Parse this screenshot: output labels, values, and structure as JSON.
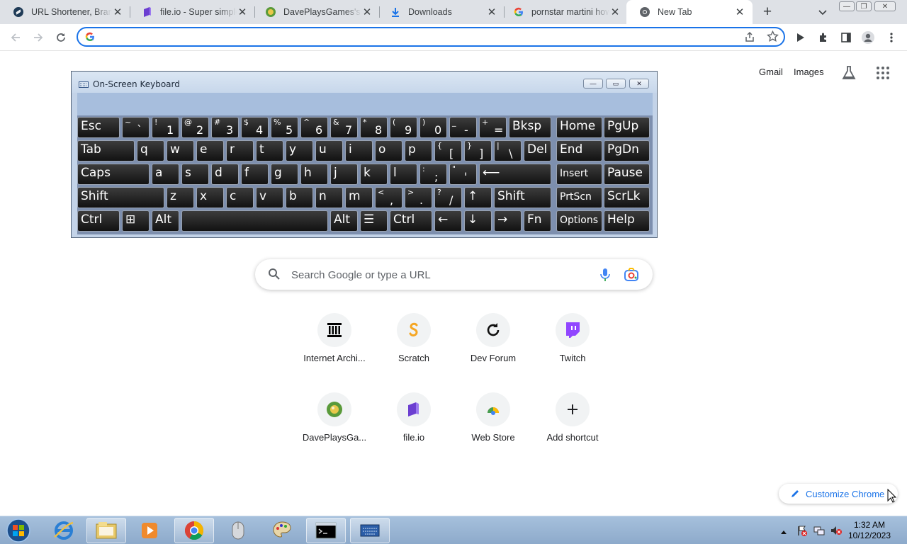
{
  "tabs": [
    {
      "title": "URL Shortener, Branded Short Links & Analytics",
      "icon": "link-icon"
    },
    {
      "title": "file.io - Super simple file sharing",
      "icon": "fileio-icon"
    },
    {
      "title": "DavePlaysGames's website",
      "icon": "globe-icon"
    },
    {
      "title": "Downloads",
      "icon": "download-icon"
    },
    {
      "title": "pornstar martini how to make",
      "icon": "google-icon"
    },
    {
      "title": "New Tab",
      "icon": "chrome-icon"
    }
  ],
  "omnibox": {
    "value": "",
    "placeholder": ""
  },
  "ntp_links": {
    "gmail": "Gmail",
    "images": "Images"
  },
  "osk": {
    "title": "On-Screen Keyboard",
    "rows": [
      [
        {
          "k": "Esc"
        },
        {
          "s": "~",
          "m": "`"
        },
        {
          "s": "!",
          "m": "1"
        },
        {
          "s": "@",
          "m": "2"
        },
        {
          "s": "#",
          "m": "3"
        },
        {
          "s": "$",
          "m": "4"
        },
        {
          "s": "%",
          "m": "5"
        },
        {
          "s": "^",
          "m": "6"
        },
        {
          "s": "&",
          "m": "7"
        },
        {
          "s": "*",
          "m": "8"
        },
        {
          "s": "(",
          "m": "9"
        },
        {
          "s": ")",
          "m": "0"
        },
        {
          "s": "_",
          "m": "-"
        },
        {
          "s": "+",
          "m": "="
        },
        {
          "k": "Bksp"
        },
        {
          "k": "Home"
        },
        {
          "k": "PgUp"
        }
      ],
      [
        {
          "k": "Tab"
        },
        {
          "k": "q"
        },
        {
          "k": "w"
        },
        {
          "k": "e"
        },
        {
          "k": "r"
        },
        {
          "k": "t"
        },
        {
          "k": "y"
        },
        {
          "k": "u"
        },
        {
          "k": "i"
        },
        {
          "k": "o"
        },
        {
          "k": "p"
        },
        {
          "s": "{",
          "m": "["
        },
        {
          "s": "}",
          "m": "]"
        },
        {
          "s": "|",
          "m": "\\"
        },
        {
          "k": "Del"
        },
        {
          "k": "End"
        },
        {
          "k": "PgDn"
        }
      ],
      [
        {
          "k": "Caps"
        },
        {
          "k": "a"
        },
        {
          "k": "s"
        },
        {
          "k": "d"
        },
        {
          "k": "f"
        },
        {
          "k": "g"
        },
        {
          "k": "h"
        },
        {
          "k": "j"
        },
        {
          "k": "k"
        },
        {
          "k": "l"
        },
        {
          "s": ":",
          "m": ";"
        },
        {
          "s": "\"",
          "m": "'"
        },
        {
          "k": "⟵"
        },
        {
          "k": "Insert"
        },
        {
          "k": "Pause"
        }
      ],
      [
        {
          "k": "Shift"
        },
        {
          "k": "z"
        },
        {
          "k": "x"
        },
        {
          "k": "c"
        },
        {
          "k": "v"
        },
        {
          "k": "b"
        },
        {
          "k": "n"
        },
        {
          "k": "m"
        },
        {
          "s": "<",
          "m": ","
        },
        {
          "s": ">",
          "m": "."
        },
        {
          "s": "?",
          "m": "/"
        },
        {
          "k": "↑"
        },
        {
          "k": "Shift"
        },
        {
          "k": "PrtScn"
        },
        {
          "k": "ScrLk"
        }
      ],
      [
        {
          "k": "Ctrl"
        },
        {
          "k": "⊞"
        },
        {
          "k": "Alt"
        },
        {
          "k": ""
        },
        {
          "k": "Alt"
        },
        {
          "k": "☰"
        },
        {
          "k": "Ctrl"
        },
        {
          "k": "←"
        },
        {
          "k": "↓"
        },
        {
          "k": "→"
        },
        {
          "k": "Fn"
        },
        {
          "k": "Options"
        },
        {
          "k": "Help"
        }
      ]
    ]
  },
  "search": {
    "placeholder": "Search Google or type a URL"
  },
  "shortcuts": [
    {
      "label": "Internet Archi...",
      "icon": "archive-icon"
    },
    {
      "label": "Scratch",
      "icon": "scratch-icon"
    },
    {
      "label": "Dev Forum",
      "icon": "refresh-icon"
    },
    {
      "label": "Twitch",
      "icon": "twitch-icon"
    },
    {
      "label": "DavePlaysGa...",
      "icon": "globe-icon"
    },
    {
      "label": "file.io",
      "icon": "fileio-icon"
    },
    {
      "label": "Web Store",
      "icon": "webstore-icon"
    },
    {
      "label": "Add shortcut",
      "icon": "plus-icon"
    }
  ],
  "customize": {
    "label": "Customize Chrome"
  },
  "clock": {
    "time": "1:32 AM",
    "date": "10/12/2023"
  },
  "colors": {
    "accent": "#1a73e8",
    "tabbar": "#dee1e6",
    "taskbar": "#9ab5d4"
  }
}
